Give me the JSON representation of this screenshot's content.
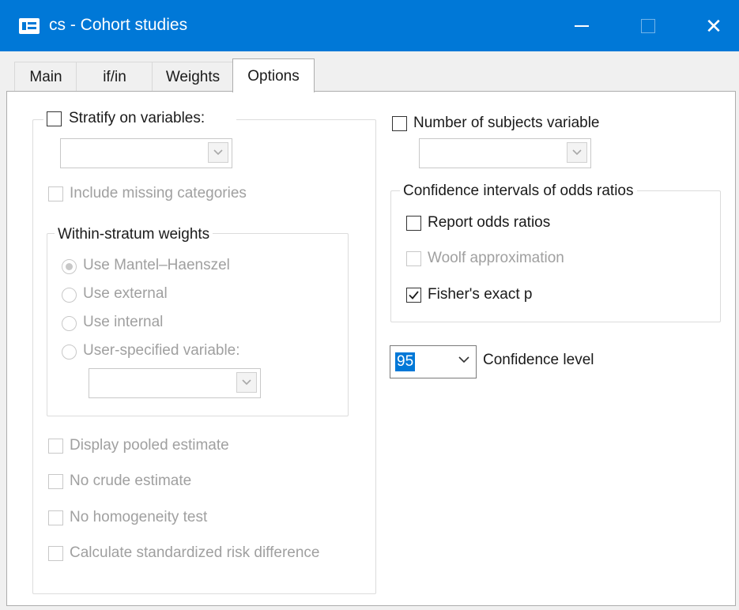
{
  "window": {
    "title": "cs - Cohort studies",
    "icon": "dialog-app-icon",
    "controls": [
      "minimize-icon",
      "maximize-icon",
      "close-icon"
    ]
  },
  "tabs": [
    {
      "label": "Main",
      "active": false
    },
    {
      "label": "if/in",
      "active": false
    },
    {
      "label": "Weights",
      "active": false
    },
    {
      "label": "Options",
      "active": true
    }
  ],
  "left": {
    "stratify": {
      "label": "Stratify on variables:",
      "checked": false,
      "combo_value": ""
    },
    "include_missing": {
      "label": "Include missing categories",
      "checked": false,
      "enabled": false
    },
    "within_stratum": {
      "title": "Within-stratum weights",
      "options": [
        {
          "label": "Use Mantel–Haenszel",
          "selected": true
        },
        {
          "label": "Use external",
          "selected": false
        },
        {
          "label": "Use internal",
          "selected": false
        },
        {
          "label": "User-specified variable:",
          "selected": false
        }
      ],
      "variable_combo_value": ""
    },
    "checks": [
      {
        "label": "Display pooled estimate",
        "checked": false,
        "enabled": false
      },
      {
        "label": "No crude estimate",
        "checked": false,
        "enabled": false
      },
      {
        "label": "No homogeneity test",
        "checked": false,
        "enabled": false
      },
      {
        "label": "Calculate standardized risk difference",
        "checked": false,
        "enabled": false
      }
    ]
  },
  "right": {
    "num_subjects": {
      "label": "Number of subjects variable",
      "checked": false,
      "combo_value": ""
    },
    "ci_group": {
      "title": "Confidence intervals of odds ratios",
      "report_odds": {
        "label": "Report odds ratios",
        "checked": false,
        "enabled": true
      },
      "woolf": {
        "label": "Woolf approximation",
        "checked": false,
        "enabled": false
      },
      "fisher": {
        "label": "Fisher's exact p",
        "checked": true,
        "enabled": true
      }
    },
    "confidence": {
      "value": "95",
      "label": "Confidence level"
    }
  },
  "colors": {
    "titlebar": "#0078d7",
    "selection": "#0078d7",
    "disabled_text": "#a0a0a0"
  }
}
